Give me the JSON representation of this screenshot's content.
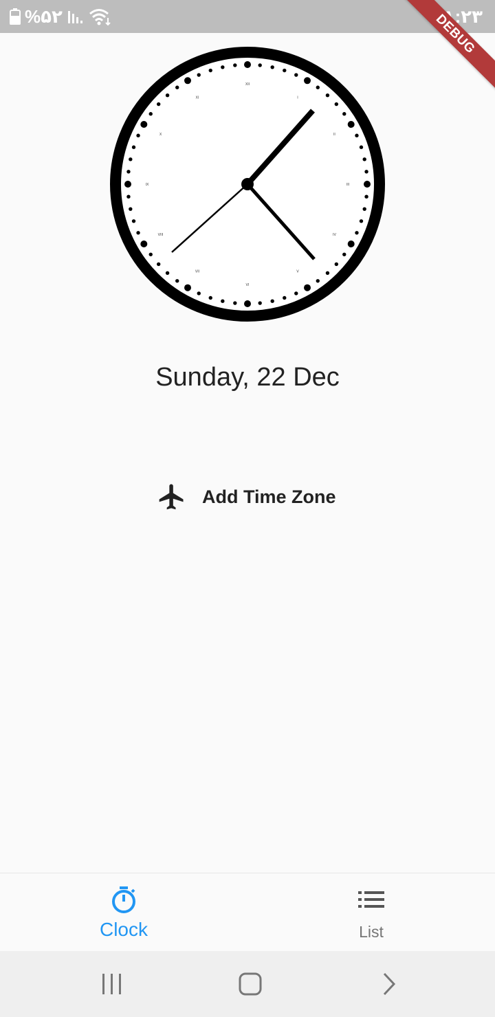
{
  "status_bar": {
    "battery_text": "%۵۲",
    "time": "۱:۲۳",
    "icons": [
      "battery-icon",
      "signal-icon",
      "wifi-icon"
    ]
  },
  "debug_banner": {
    "label": "DEBUG"
  },
  "clock": {
    "numerals": [
      "XII",
      "I",
      "II",
      "III",
      "IV",
      "V",
      "VI",
      "VII",
      "VIII",
      "IX",
      "X",
      "XI"
    ],
    "colors": {
      "face": "#ffffff",
      "rim": "#000000",
      "hands": "#000000"
    }
  },
  "date": {
    "text": "Sunday,  22 Dec"
  },
  "add_time_zone": {
    "label": "Add Time Zone",
    "icon": "airplane-icon"
  },
  "bottom_nav": {
    "items": [
      {
        "label": "Clock",
        "icon": "timer-icon",
        "active": true,
        "color": "#2196f3"
      },
      {
        "label": "List",
        "icon": "list-icon",
        "active": false,
        "color": "#757575"
      }
    ]
  },
  "system_nav": {
    "buttons": [
      "recents-icon",
      "home-icon",
      "back-icon"
    ]
  }
}
